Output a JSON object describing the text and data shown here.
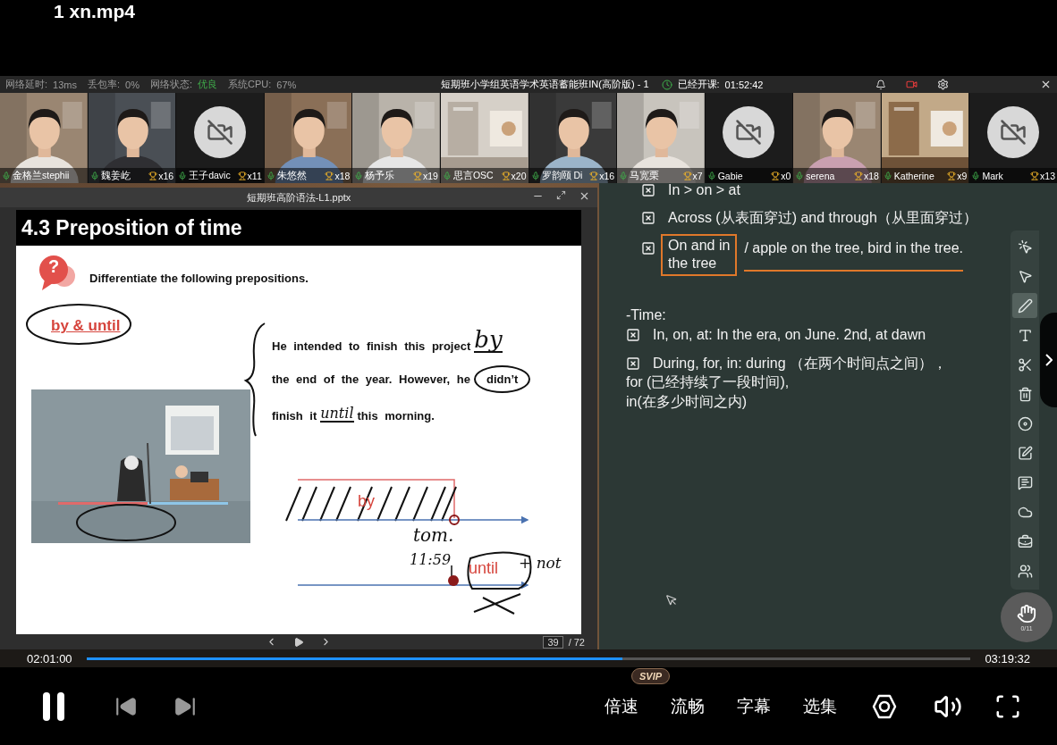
{
  "file_title": "1 xn.mp4",
  "status_bar": {
    "stats": [
      {
        "label": "网络延时:",
        "value": "13ms",
        "good": false
      },
      {
        "label": "丢包率:",
        "value": "0%",
        "good": false
      },
      {
        "label": "网络状态:",
        "value": "优良",
        "good": true
      },
      {
        "label": "系统CPU:",
        "value": "67%",
        "good": false
      }
    ],
    "class_title": "短期班小学组英语学术英语蓄能班IN(高阶版) - 1",
    "elapsed_label": "已经开课:",
    "elapsed": "01:52:42"
  },
  "participants": [
    {
      "name": "金格兰stephii",
      "kind": "person"
    },
    {
      "name": "魏姜屹",
      "trophies": "x16",
      "kind": "person"
    },
    {
      "name": "王子davic",
      "trophies": "x11",
      "kind": "off"
    },
    {
      "name": "朱悠然",
      "trophies": "x18",
      "kind": "person"
    },
    {
      "name": "杨予乐",
      "trophies": "x19",
      "kind": "person"
    },
    {
      "name": "思言OSC",
      "trophies": "x20",
      "kind": "room"
    },
    {
      "name": "罗韵颐 Di",
      "trophies": "x16",
      "kind": "person"
    },
    {
      "name": "马宽栗",
      "trophies": "x7",
      "kind": "person"
    },
    {
      "name": "Gabie",
      "trophies": "x0",
      "kind": "off"
    },
    {
      "name": "serena",
      "trophies": "x18",
      "kind": "person"
    },
    {
      "name": "Katherine",
      "trophies": "x9",
      "kind": "room"
    },
    {
      "name": "Mark",
      "trophies": "x13",
      "kind": "off"
    }
  ],
  "presentation": {
    "window_title": "短期班高阶语法-L1.pptx",
    "slide": {
      "title": "4.3 Preposition of time",
      "icon_glyph": "?",
      "prompt": "Differentiate the following prepositions.",
      "topic": "by & until",
      "line_1": "He intended to finish this project",
      "ink_by": "by",
      "line_2": "the end of the year. However, he",
      "circled": "didn’t",
      "line_3_start": "finish it",
      "ink_until": "until",
      "line_3_end": "this morning.",
      "diagram": {
        "by": "by",
        "tom": "tom.",
        "time": "11:59",
        "until": "until",
        "not": "+ not"
      }
    },
    "page": "39",
    "total": "/ 72"
  },
  "board": {
    "items": [
      {
        "kind": "plain",
        "text": "In > on > at"
      },
      {
        "kind": "plain",
        "text": "Across (从表面穿过) and through（从里面穿过）"
      },
      {
        "kind": "boxed",
        "text": "On and in",
        "note": "the tree",
        "rest": "/ apple on the tree, bird in the tree."
      }
    ],
    "time_heading": "-Time:",
    "time_items": [
      {
        "text": "In, on, at: In the era, on June. 2nd, at dawn"
      },
      {
        "text": "During, for, in: during （在两个时间点之间），",
        "continuation": [
          "for (已经持续了一段时间),",
          "in(在多少时间之内)"
        ]
      }
    ]
  },
  "tools": [
    {
      "kind": "laser",
      "selected": false
    },
    {
      "kind": "select",
      "selected": false
    },
    {
      "kind": "pen",
      "selected": true
    },
    {
      "kind": "text",
      "selected": false
    },
    {
      "kind": "scissors",
      "selected": false
    },
    {
      "kind": "eraser",
      "selected": false
    },
    {
      "kind": "shape",
      "selected": false
    },
    {
      "kind": "note",
      "selected": false
    },
    {
      "kind": "chat",
      "selected": false
    },
    {
      "kind": "cloud",
      "selected": false
    },
    {
      "kind": "toolbox",
      "selected": false
    },
    {
      "kind": "users",
      "selected": false
    }
  ],
  "raise_hand": {
    "count": "0/11"
  },
  "progress": {
    "current": "02:01:00",
    "duration": "03:19:32",
    "level": 0.606
  },
  "controls": {
    "playing": true,
    "options": [
      {
        "label": "倍速",
        "badge": "SVIP"
      },
      {
        "label": "流畅"
      },
      {
        "label": "字幕"
      },
      {
        "label": "选集"
      }
    ]
  }
}
